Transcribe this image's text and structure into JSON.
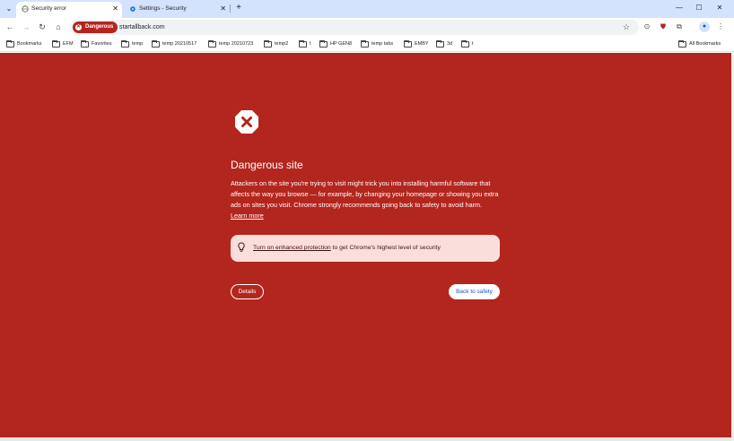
{
  "tabs": [
    {
      "title": "Security error",
      "active": true
    },
    {
      "title": "Settings - Security",
      "active": false
    }
  ],
  "window_controls": {
    "minimize": "—",
    "maximize": "☐",
    "close": "✕"
  },
  "toolbar": {
    "back": "←",
    "forward": "→",
    "reload": "↻",
    "home": "⌂",
    "security_chip": "Dangerous",
    "url": "startallback.com",
    "menu": "⋮"
  },
  "bookmarks": [
    {
      "label": "Bookmarks"
    },
    {
      "label": "EFM"
    },
    {
      "label": "Favorites"
    },
    {
      "label": "temp"
    },
    {
      "label": "temp 20210517"
    },
    {
      "label": "temp 20210723"
    },
    {
      "label": "temp2"
    },
    {
      "label": "t"
    },
    {
      "label": "HP GEN8"
    },
    {
      "label": "temp tabs"
    },
    {
      "label": "EMBY"
    },
    {
      "label": "3d"
    },
    {
      "label": "t"
    }
  ],
  "all_bookmarks": "All Bookmarks",
  "warning": {
    "heading": "Dangerous site",
    "body": "Attackers on the site you're trying to visit might trick you into installing harmful software that affects the way you browse — for example, by changing your homepage or showing you extra ads on sites you visit. Chrome strongly recommends going back to safety to avoid harm.",
    "learn_more": "Learn more",
    "callout_link": "Turn on enhanced protection",
    "callout_rest": " to get Chrome's highest level of security",
    "details_button": "Details",
    "back_button": "Back to safety"
  },
  "colors": {
    "page_bg": "#b3261e",
    "callout_bg": "#f9dedc",
    "tabstrip": "#d3e3fd"
  }
}
